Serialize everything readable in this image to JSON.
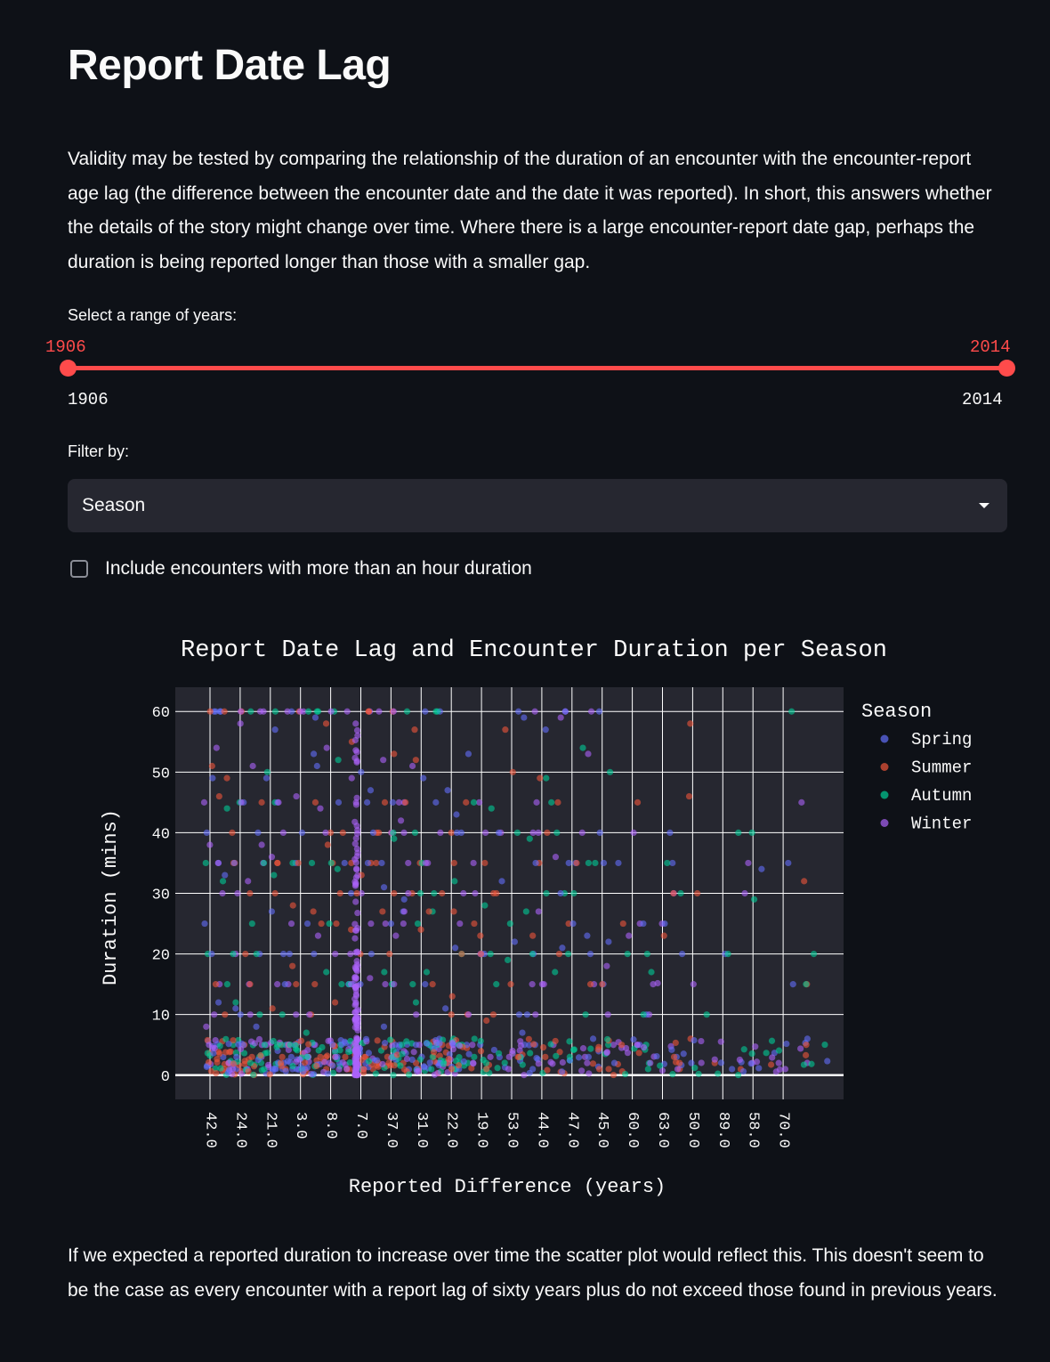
{
  "page": {
    "title": "Report Date Lag",
    "intro": "Validity may be tested by comparing the relationship of the duration of an encounter with the encounter-report age lag (the difference between the encounter date and the date it was reported). In short, this answers whether the details of the story might change over time. Where there is a large encounter-report date gap, perhaps the duration is being reported longer than those with a smaller gap.",
    "conclusion": "If we expected a reported duration to increase over time the scatter plot would reflect this. This doesn't seem to be the case as every encounter with a report lag of sixty years plus do not exceed those found in previous years."
  },
  "slider": {
    "label": "Select a range of years:",
    "value_low": "1906",
    "value_high": "2014",
    "min_label": "1906",
    "max_label": "2014",
    "range_fraction": [
      0,
      1
    ],
    "color": "#ff4b4b"
  },
  "filter": {
    "label": "Filter by:",
    "selected": "Season"
  },
  "checkbox": {
    "label": "Include encounters with more than an hour duration",
    "checked": false
  },
  "chart_data": {
    "type": "scatter",
    "title": "Report Date Lag and Encounter Duration per Season",
    "xlabel": "Reported Difference (years)",
    "ylabel": "Duration (mins)",
    "legend_title": "Season",
    "legend_position": "right",
    "grid": true,
    "plot_background": "#262730",
    "x_categories": [
      "42.0",
      "24.0",
      "21.0",
      "3.0",
      "8.0",
      "7.0",
      "37.0",
      "31.0",
      "22.0",
      "19.0",
      "53.0",
      "44.0",
      "47.0",
      "45.0",
      "60.0",
      "63.0",
      "50.0",
      "89.0",
      "58.0",
      "70.0"
    ],
    "yticks": [
      0,
      10,
      20,
      30,
      40,
      50,
      60
    ],
    "ylim": [
      -4,
      64
    ],
    "series": [
      {
        "name": "Spring",
        "color": "#636efa"
      },
      {
        "name": "Summer",
        "color": "#ef553b"
      },
      {
        "name": "Autumn",
        "color": "#00cc96"
      },
      {
        "name": "Winter",
        "color": "#ab63fa"
      }
    ]
  }
}
